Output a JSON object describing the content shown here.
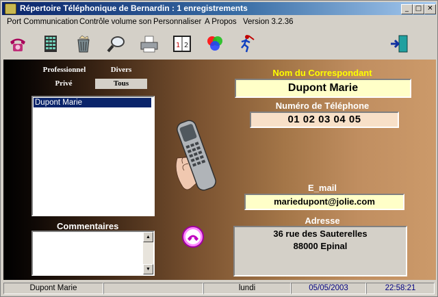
{
  "window": {
    "title": "Répertoire Téléphonique de Bernardin :  1 enregistrements",
    "buttons": {
      "minimize": "_",
      "maximize": "□",
      "close": "✕"
    }
  },
  "menu": {
    "items": [
      "Port Communication",
      "Contrôle volume son",
      "Personnaliser",
      "A Propos"
    ],
    "version": "Version 3.2.36"
  },
  "toolbar": {
    "icons": [
      "phone-dial-icon",
      "keypad-icon",
      "trash-icon",
      "search-icon",
      "printer-icon",
      "calendar-icon",
      "color-palette-icon",
      "runner-icon",
      "exit-door-icon"
    ]
  },
  "tabs": {
    "professionnel": "Professionnel",
    "divers": "Divers",
    "prive": "Privé",
    "tous": "Tous"
  },
  "contacts": [
    "Dupont Marie"
  ],
  "commentaires": {
    "label": "Commentaires",
    "value": ""
  },
  "correspondant": {
    "label": "Nom du Correspondant",
    "value": "Dupont Marie"
  },
  "telephone": {
    "label": "Numéro de Téléphone",
    "value": "01 02 03 04 05"
  },
  "email": {
    "label": "E_mail",
    "value": "mariedupont@jolie.com"
  },
  "adresse": {
    "label": "Adresse",
    "line1": "36 rue des Sauterelles",
    "line2": "88000 Epinal"
  },
  "status": {
    "name": "Dupont Marie",
    "empty": "",
    "day": "lundi",
    "date": "05/05/2003",
    "time": "22:58:21"
  },
  "colors": {
    "titlebar": "#0a246a",
    "label_yellow": "#ffff00",
    "field_yellow": "#ffffc8",
    "field_peach": "#f8e0c8",
    "field_grey": "#d4d0c8",
    "status_blue": "#000080"
  }
}
